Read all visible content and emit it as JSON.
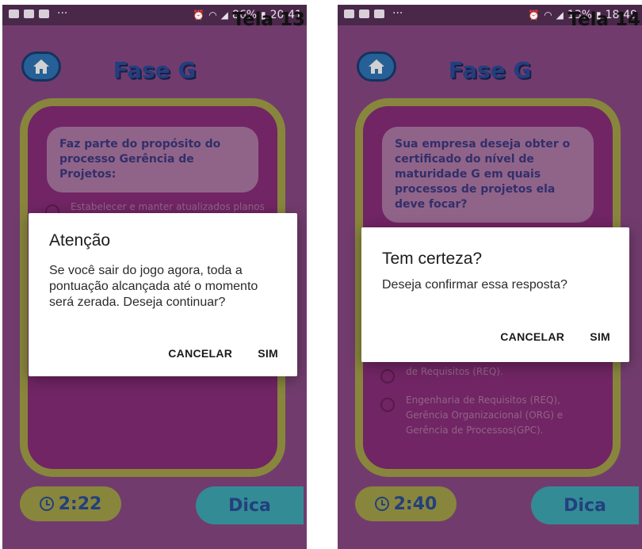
{
  "colors": {
    "background": "#8a4a86",
    "frame_border": "#a7a44a",
    "title_blue": "#2d4c9a",
    "hint_button": "#3faab8",
    "home_button": "#2f76b8",
    "status_bar": "#49284a",
    "dialog_bg": "#ffffff"
  },
  "left": {
    "status": {
      "dots": "···",
      "battery_percent": "86%",
      "time": "20:41"
    },
    "screen_label": "Tela 13",
    "phase_title": "Fase G",
    "question": "Faz parte do propósito do processo Gerência de Projetos:",
    "options": [
      {
        "text": "Estabelecer e manter atualizados planos que definam as"
      }
    ],
    "timer": "2:22",
    "hint_label": "Dica",
    "dialog": {
      "title": "Atenção",
      "message": "Se você sair do jogo agora, toda a pontuação alcançada até o momento será zerada. Deseja continuar?",
      "cancel_label": "CANCELAR",
      "confirm_label": "SIM"
    }
  },
  "right": {
    "status": {
      "dots": "···",
      "battery_percent": "13%",
      "time": "18:49"
    },
    "screen_label": "Tela 14",
    "phase_title": "Fase G",
    "question": "Sua empresa deseja obter o certificado do nível de maturidade G em quais processos de projetos ela deve focar?",
    "options": [
      {
        "text": "de Requisitos (REQ)."
      },
      {
        "text": "Engenharia de Requisitos (REQ), Gerência Organizacional (ORG) e Gerência de Processos(GPC)."
      }
    ],
    "timer": "2:40",
    "hint_label": "Dica",
    "dialog": {
      "title": "Tem certeza?",
      "message": "Deseja confirmar essa resposta?",
      "cancel_label": "CANCELAR",
      "confirm_label": "SIM"
    }
  }
}
